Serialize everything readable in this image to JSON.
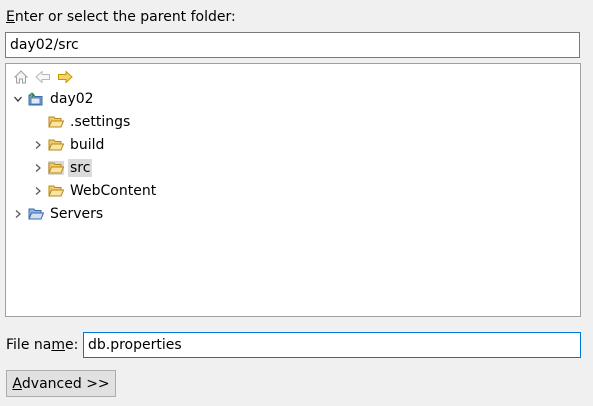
{
  "parent_folder": {
    "label_mnemonic": "E",
    "label_rest": "nter or select the parent folder:",
    "value": "day02/src"
  },
  "toolbar": {
    "icons": [
      "home-icon",
      "back-arrow-icon",
      "forward-arrow-icon"
    ]
  },
  "tree": {
    "nodes": [
      {
        "label": "day02",
        "level": 0,
        "expanded": true,
        "type": "project"
      },
      {
        "label": ".settings",
        "level": 1,
        "expanded": null,
        "type": "folder"
      },
      {
        "label": "build",
        "level": 1,
        "expanded": false,
        "type": "folder"
      },
      {
        "label": "src",
        "level": 1,
        "expanded": false,
        "type": "folder",
        "selected": true
      },
      {
        "label": "WebContent",
        "level": 1,
        "expanded": false,
        "type": "folder"
      },
      {
        "label": "Servers",
        "level": 0,
        "expanded": false,
        "type": "folder-open"
      }
    ]
  },
  "file_name": {
    "label_pre": "File na",
    "label_mnemonic": "m",
    "label_post": "e:",
    "value": "db.properties"
  },
  "advanced_button": {
    "mnemonic": "A",
    "rest": "dvanced >>"
  },
  "colors": {
    "background": "#f0f0f0",
    "selection": "#dadada",
    "focus_border": "#0078d7",
    "folder": "#e8b84a"
  }
}
